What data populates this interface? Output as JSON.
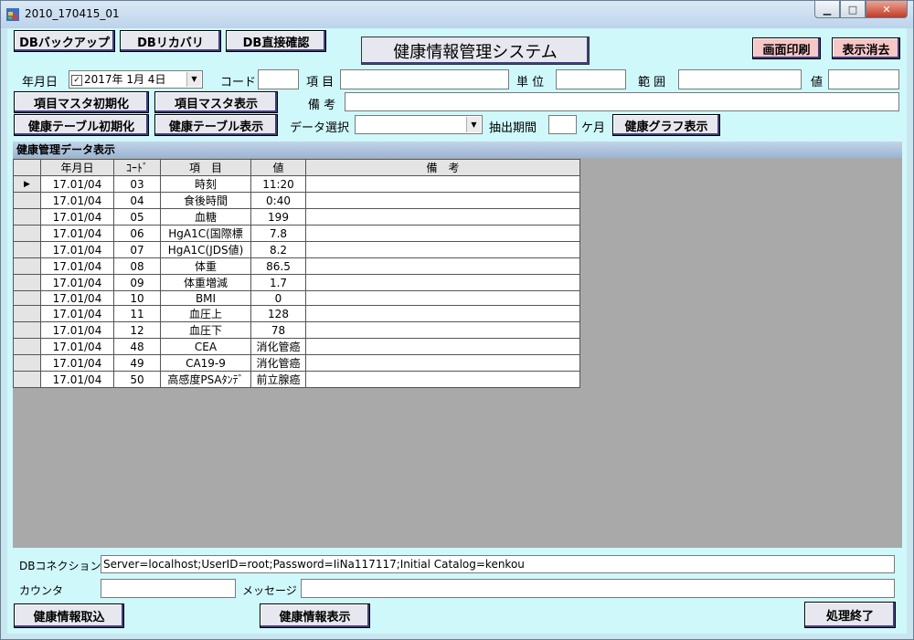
{
  "window": {
    "title": "2010_170415_01"
  },
  "toolbar": {
    "db_backup": "DBバックアップ",
    "db_recovery": "DBリカバリ",
    "db_direct_check": "DB直接確認",
    "app_title": "健康情報管理システム",
    "print_screen": "画面印刷",
    "clear_display": "表示消去"
  },
  "form": {
    "date_label": "年月日",
    "date_value": "2017年 1月 4日",
    "code_label": "コード",
    "item_label": "項 目",
    "unit_label": "単 位",
    "range_label": "範 囲",
    "value_label": "値",
    "remarks_label": "備 考",
    "data_select_label": "データ選択",
    "period_label": "抽出期間",
    "month_label": "ケ月"
  },
  "buttons": {
    "item_master_init": "項目マスタ初期化",
    "item_master_show": "項目マスタ表示",
    "health_table_init": "健康テーブル初期化",
    "health_table_show": "健康テーブル表示",
    "health_graph_show": "健康グラフ表示",
    "health_import": "健康情報取込",
    "health_show": "健康情報表示",
    "exit": "処理終了"
  },
  "grid": {
    "caption": "健康管理データ表示",
    "columns": [
      "年月日",
      "ｺｰﾄﾞ",
      "項　目",
      "値",
      "備　考"
    ],
    "rows": [
      [
        "17.01/04",
        "03",
        "時刻",
        "11:20",
        ""
      ],
      [
        "17.01/04",
        "04",
        "食後時間",
        "0:40",
        ""
      ],
      [
        "17.01/04",
        "05",
        "血糖",
        "199",
        ""
      ],
      [
        "17.01/04",
        "06",
        "HgA1C(国際標",
        "7.8",
        ""
      ],
      [
        "17.01/04",
        "07",
        "HgA1C(JDS値)",
        "8.2",
        ""
      ],
      [
        "17.01/04",
        "08",
        "体重",
        "86.5",
        ""
      ],
      [
        "17.01/04",
        "09",
        "体重増減",
        "1.7",
        ""
      ],
      [
        "17.01/04",
        "10",
        "BMI",
        "0",
        ""
      ],
      [
        "17.01/04",
        "11",
        "血圧上",
        "128",
        ""
      ],
      [
        "17.01/04",
        "12",
        "血圧下",
        "78",
        ""
      ],
      [
        "17.01/04",
        "48",
        "CEA",
        "消化管癌",
        ""
      ],
      [
        "17.01/04",
        "49",
        "CA19-9",
        "消化管癌",
        ""
      ],
      [
        "17.01/04",
        "50",
        "高感度PSAﾀﾝﾃﾞ",
        "前立腺癌",
        ""
      ]
    ]
  },
  "footer": {
    "db_connection_label": "DBコネクション",
    "db_connection_value": "Server=localhost;UserID=root;Password=IiNa117117;Initial Catalog=kenkou",
    "counter_label": "カウンタ",
    "message_label": "メッセージ"
  }
}
